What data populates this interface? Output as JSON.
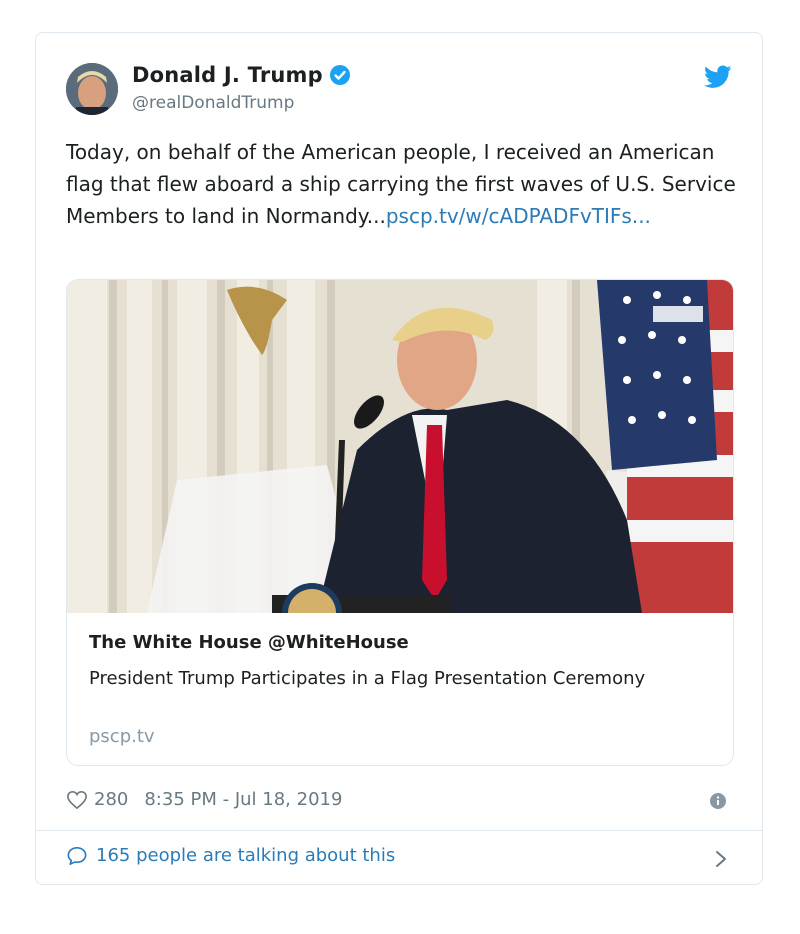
{
  "tweet": {
    "author_name": "Donald J. Trump",
    "handle": "@realDonaldTrump",
    "text_prefix": "Today, on behalf of the American people, I received an American flag that flew aboard a ship carrying the first waves of U.S. Service Members to land in Normandy...",
    "link_text": "pscp.tv/w/cADPADFvTIFs...",
    "likes": "280",
    "timestamp": "8:35 PM - Jul 18, 2019",
    "talking": "165 people are talking about this"
  },
  "card": {
    "title": "The White House @WhiteHouse",
    "description": "President Trump Participates in a Flag Presentation Ceremony",
    "domain": "pscp.tv"
  },
  "colors": {
    "link": "#2b7bb9",
    "verified": "#1da1f2",
    "muted": "#697882",
    "border": "#e1e8ed"
  },
  "icons": [
    "verified-badge-icon",
    "twitter-bird-icon",
    "heart-icon",
    "info-icon",
    "speech-bubble-icon",
    "chevron-right-icon"
  ]
}
